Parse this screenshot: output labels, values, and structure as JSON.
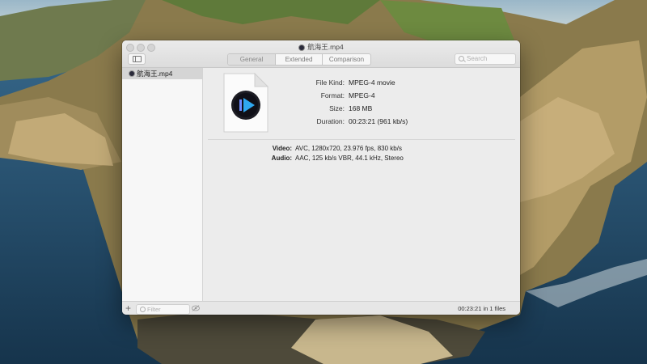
{
  "window": {
    "title": "航海王.mp4",
    "tabs": [
      {
        "label": "General",
        "active": true
      },
      {
        "label": "Extended",
        "active": false
      },
      {
        "label": "Comparison",
        "active": false
      }
    ],
    "search_placeholder": "Search"
  },
  "sidebar": {
    "files": [
      {
        "name": "航海王.mp4",
        "selected": true
      }
    ],
    "filter_placeholder": "Filter",
    "add_label": "+"
  },
  "general": {
    "properties": [
      {
        "label": "File Kind:",
        "value": "MPEG-4 movie"
      },
      {
        "label": "Format:",
        "value": "MPEG-4"
      },
      {
        "label": "Size:",
        "value": "168 MB"
      },
      {
        "label": "Duration:",
        "value": "00:23:21 (961 kb/s)"
      }
    ],
    "streams": [
      {
        "label": "Video:",
        "value": "AVC, 1280x720, 23.976 fps, 830 kb/s"
      },
      {
        "label": "Audio:",
        "value": "AAC, 125 kb/s VBR, 44.1 kHz, Stereo"
      }
    ]
  },
  "status_bar": {
    "text": "00:23:21 in 1 files"
  },
  "colors": {
    "accent_play": "#1e88e5",
    "selection": "#d5d5d5"
  }
}
